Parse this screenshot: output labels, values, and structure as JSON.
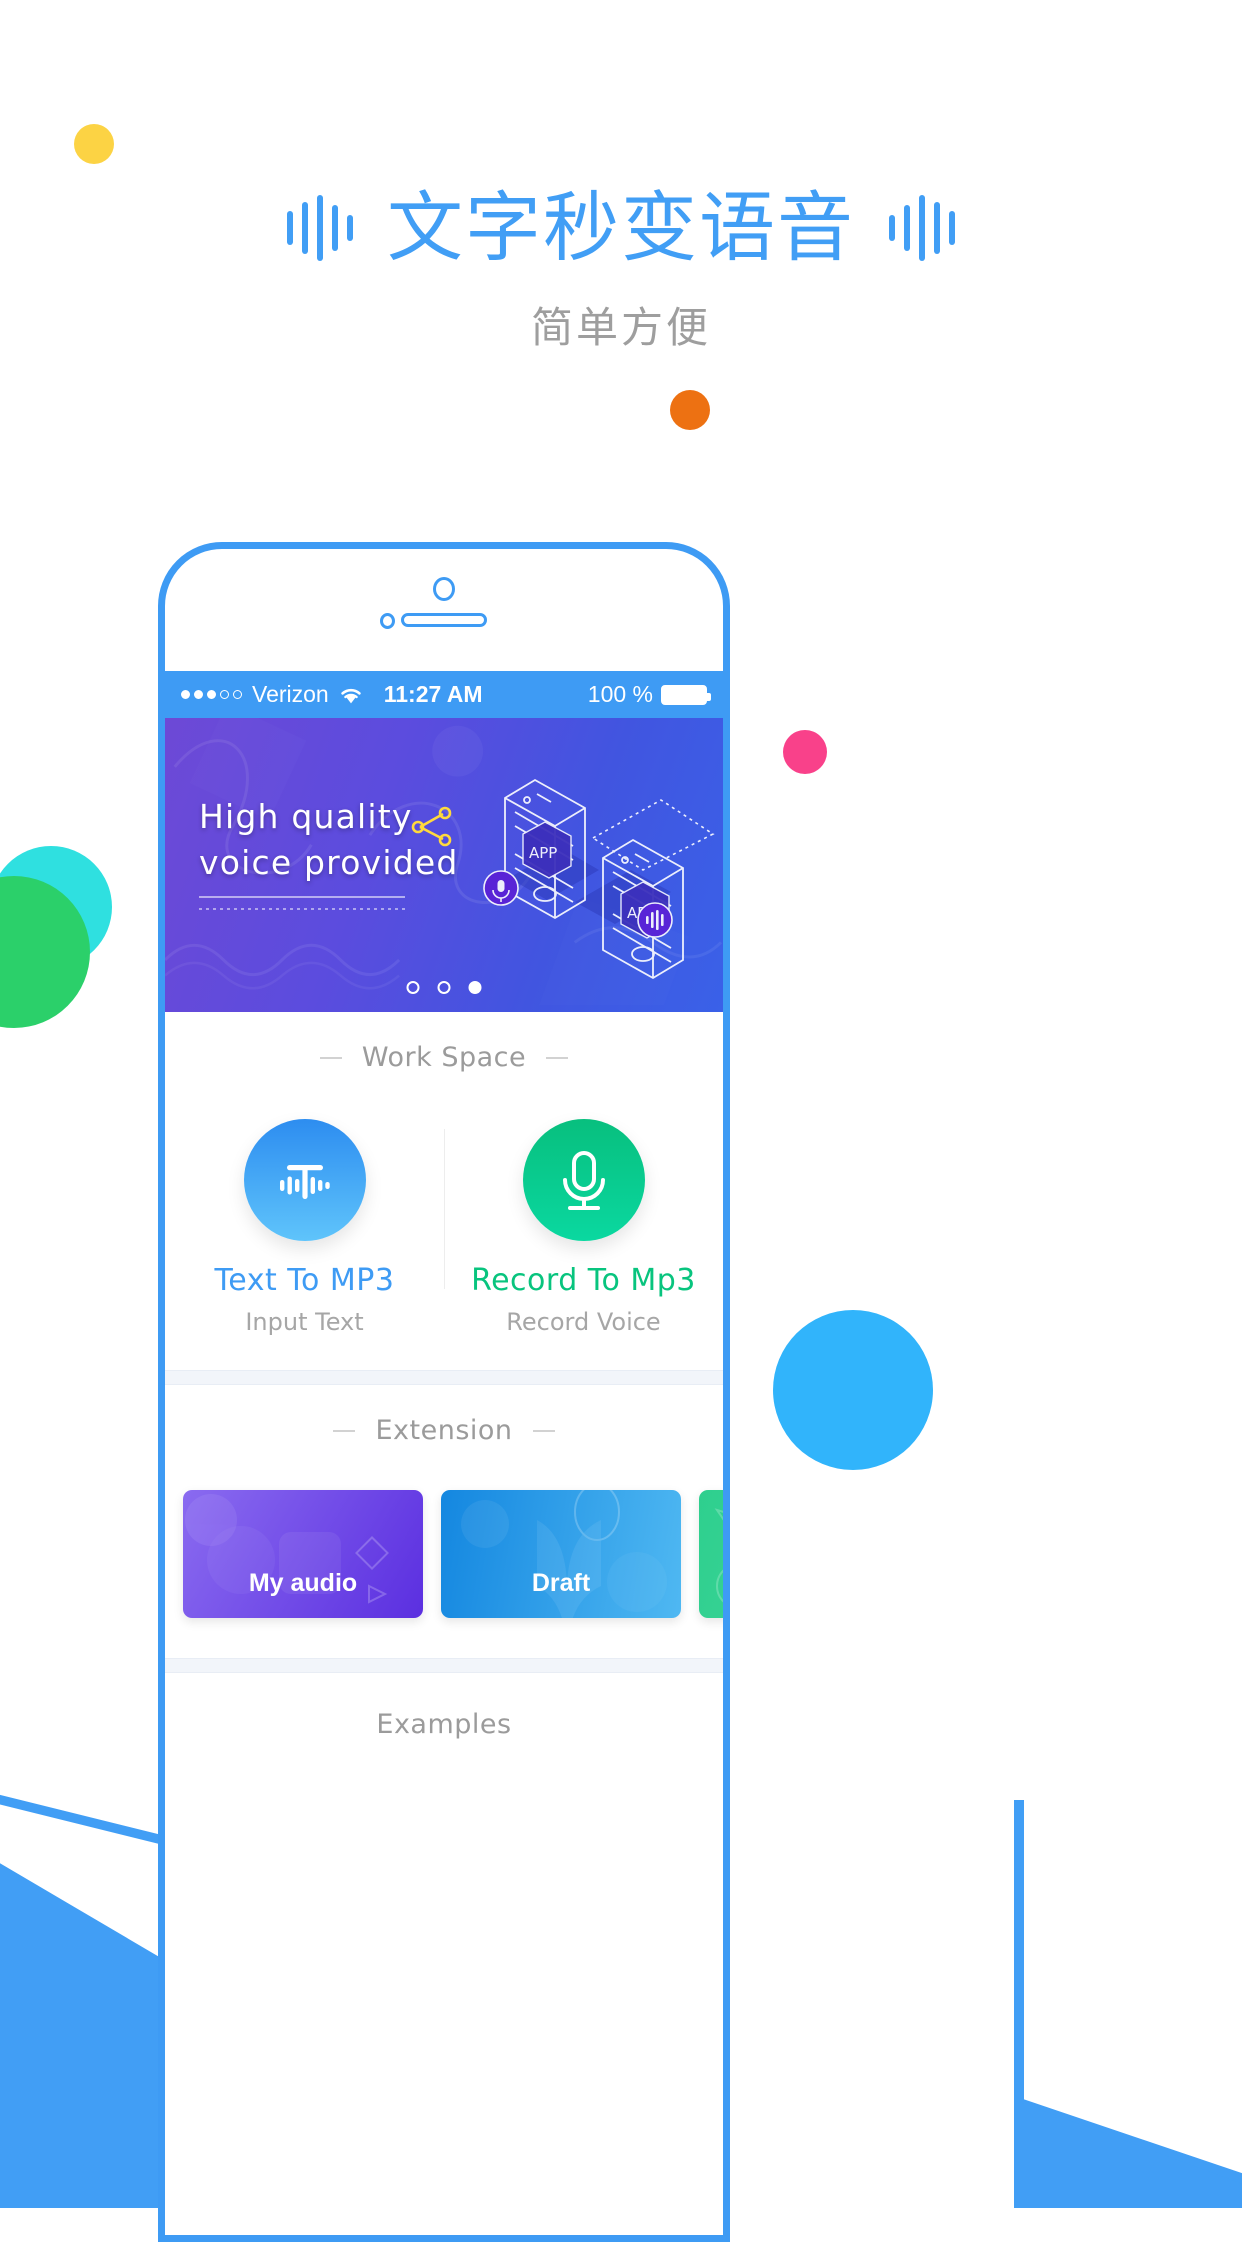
{
  "hero": {
    "title": "文字秒变语音",
    "subtitle": "简单方便",
    "title_color": "#419EF5",
    "subtitle_color": "#9E9E9E"
  },
  "phone": {
    "status_bar": {
      "signal_dots_filled": 3,
      "signal_dots_total": 5,
      "carrier": "Verizon",
      "wifi_icon": "wifi-icon",
      "time": "11:27 AM",
      "battery_percent": "100 %",
      "battery_icon": "battery-full-icon",
      "background": "#3E9BF4"
    },
    "banner": {
      "line1": "High quality",
      "line2": "voice provided",
      "share_icon": "share-icon",
      "share_icon_color": "#FFD93D",
      "carousel": {
        "total": 3,
        "active_index": 2
      },
      "art_labels": [
        "APP",
        "APP"
      ],
      "art_icons": [
        "microphone-icon",
        "sound-wave-icon"
      ],
      "gradient_from": "#6D49D6",
      "gradient_to": "#3A61E8"
    },
    "work_space": {
      "header": "Work Space",
      "items": [
        {
          "title": "Text To MP3",
          "subtitle": "Input Text",
          "icon": "text-to-speech-icon",
          "color": "#3E9BF4"
        },
        {
          "title": "Record To Mp3",
          "subtitle": "Record Voice",
          "icon": "microphone-icon",
          "color": "#08C47E"
        }
      ]
    },
    "extension": {
      "header": "Extension",
      "cards": [
        {
          "label": "My audio",
          "color_from": "#8A6BF0",
          "color_to": "#5B2FE0"
        },
        {
          "label": "Draft",
          "color_from": "#1487E0",
          "color_to": "#4FB8F2"
        },
        {
          "label": "",
          "color_from": "#2ECF8E",
          "color_to": "#4AD9A0"
        }
      ]
    },
    "examples": {
      "header": "Examples"
    }
  },
  "decor": {
    "yellow_dot": "#FCD344",
    "orange_dot": "#ED7112",
    "pink_dot": "#F9418A",
    "cyan_dot": "#2FE0E0",
    "green_dot": "#2BD06A",
    "blue_circle": "#31B4FB",
    "blue_diagonal": "#419EF5"
  }
}
